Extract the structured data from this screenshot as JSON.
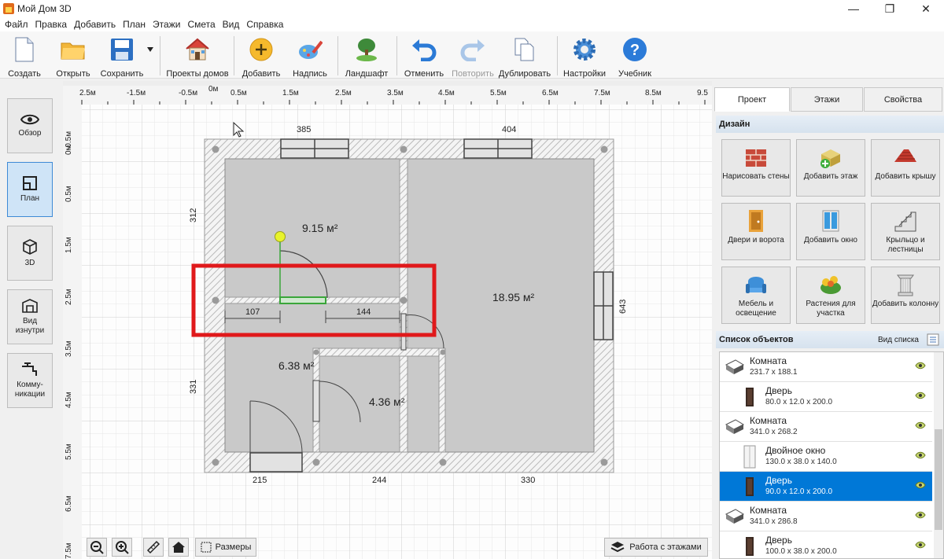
{
  "window": {
    "title": "Мой Дом 3D",
    "minimize": "—",
    "maximize": "❐",
    "close": "✕"
  },
  "menu": [
    "Файл",
    "Правка",
    "Добавить",
    "План",
    "Этажи",
    "Смета",
    "Вид",
    "Справка"
  ],
  "toolbar": {
    "create": "Создать",
    "open": "Открыть",
    "save": "Сохранить",
    "house_projects": "Проекты домов",
    "add": "Добавить",
    "label": "Надпись",
    "landscape": "Ландшафт",
    "undo": "Отменить",
    "redo": "Повторить",
    "duplicate": "Дублировать",
    "settings": "Настройки",
    "tutorial": "Учебник"
  },
  "views": [
    "Обзор",
    "План",
    "3D",
    "Вид изнутри",
    "Комму- никации"
  ],
  "ruler": {
    "top": [
      "2.5м",
      "-1.5м",
      "-0.5м",
      "0м",
      "0.5м",
      "1.5м",
      "2.5м",
      "3.5м",
      "4.5м",
      "5.5м",
      "6.5м",
      "7.5м",
      "8.5м",
      "9.5"
    ],
    "left": [
      "-0.5м",
      "0м",
      "0.5м",
      "1.5м",
      "2.5м",
      "3.5м",
      "4.5м",
      "5.5м",
      "6.5м",
      "7.5м"
    ]
  },
  "plan": {
    "dims": {
      "top_left": "385",
      "top_right": "404",
      "left_top": "312",
      "left_bottom": "331",
      "right": "643",
      "bottom_left": "215",
      "bottom_mid": "244",
      "bottom_right": "330",
      "seg_a": "107",
      "seg_b": "144"
    },
    "areas": {
      "room1": "9.15 м²",
      "room2": "18.95 м²",
      "room3": "6.38 м²",
      "room4": "4.36 м²"
    }
  },
  "bottombar": {
    "sizes": "Размеры",
    "floors": "Работа с этажами"
  },
  "rightpanel": {
    "tabs": [
      "Проект",
      "Этажи",
      "Свойства"
    ],
    "design_title": "Дизайн",
    "design_buttons": [
      "Нарисовать стены",
      "Добавить этаж",
      "Добавить крышу",
      "Двери и ворота",
      "Добавить окно",
      "Крыльцо и лестницы",
      "Мебель и освещение",
      "Растения для участка",
      "Добавить колонну"
    ],
    "objects_title": "Список объектов",
    "view_list": "Вид списка",
    "objects": [
      {
        "name": "Комната",
        "dims": "231.7 x 188.1"
      },
      {
        "name": "Дверь",
        "dims": "80.0 x 12.0 x 200.0"
      },
      {
        "name": "Комната",
        "dims": "341.0 x 268.2"
      },
      {
        "name": "Двойное окно",
        "dims": "130.0 x 38.0 x 140.0"
      },
      {
        "name": "Дверь",
        "dims": "90.0 x 12.0 x 200.0"
      },
      {
        "name": "Комната",
        "dims": "341.0 x 286.8"
      },
      {
        "name": "Дверь",
        "dims": "100.0 x 38.0 x 200.0"
      }
    ]
  },
  "colors": {
    "accent": "#0078d7",
    "highlight": "#e0191b",
    "wall": "#c8c8c8",
    "selected_wall": "#3aa63a"
  }
}
